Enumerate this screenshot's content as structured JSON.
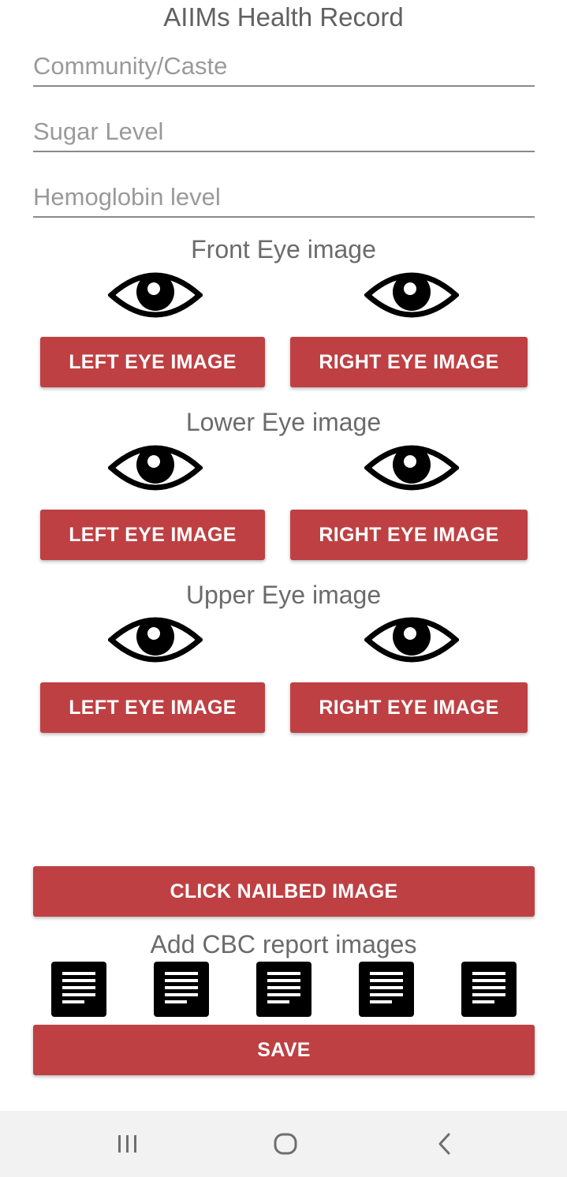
{
  "app": {
    "title": "AIIMs Health Record"
  },
  "fields": {
    "community": {
      "placeholder": "Community/Caste",
      "value": ""
    },
    "sugar": {
      "placeholder": "Sugar Level",
      "value": ""
    },
    "hemoglobin": {
      "placeholder": "Hemoglobin level",
      "value": ""
    }
  },
  "sections": [
    {
      "label": "Front Eye image",
      "left_button": "LEFT EYE IMAGE",
      "right_button": "RIGHT EYE IMAGE"
    },
    {
      "label": "Lower Eye image",
      "left_button": "LEFT EYE IMAGE",
      "right_button": "RIGHT EYE IMAGE"
    },
    {
      "label": "Upper Eye image",
      "left_button": "LEFT EYE IMAGE",
      "right_button": "RIGHT EYE IMAGE"
    }
  ],
  "nailbed": {
    "button": "CLICK NAILBED IMAGE"
  },
  "cbc": {
    "label": "Add CBC report images",
    "icons": [
      "document-icon",
      "document-icon",
      "document-icon",
      "document-icon",
      "document-icon"
    ]
  },
  "save": {
    "button": "SAVE"
  },
  "navbar": {
    "icons": [
      "recent-apps-icon",
      "home-icon",
      "back-icon"
    ]
  },
  "colors": {
    "accent": "#be4043",
    "background": "#ffffff",
    "navbar": "#f2f2f2"
  }
}
